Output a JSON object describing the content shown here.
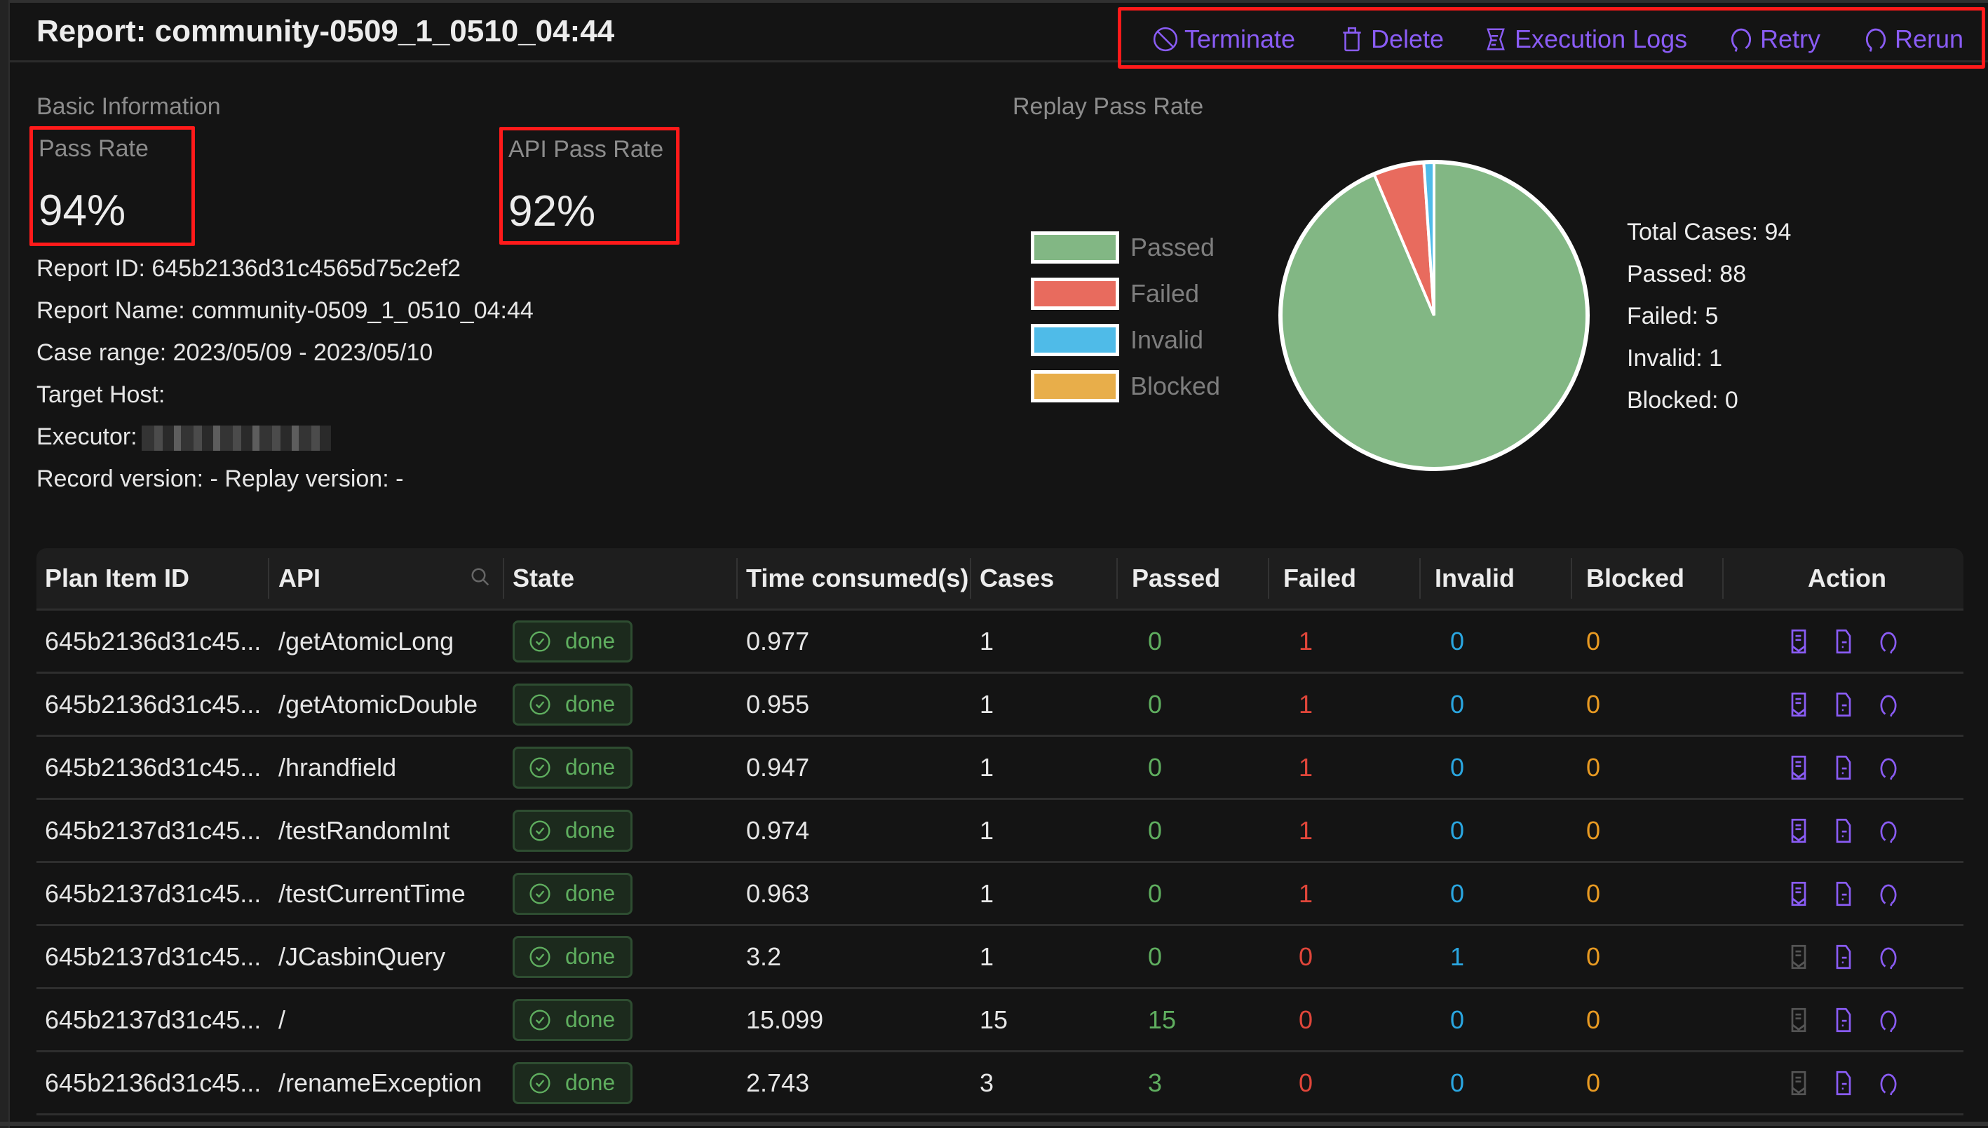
{
  "header": {
    "title": "Report: community-0509_1_0510_04:44",
    "actions": [
      {
        "label": "Terminate",
        "icon": "ban-icon"
      },
      {
        "label": "Delete",
        "icon": "trash-icon"
      },
      {
        "label": "Execution Logs",
        "icon": "scroll-icon"
      },
      {
        "label": "Retry",
        "icon": "refresh-icon"
      },
      {
        "label": "Rerun",
        "icon": "refresh-icon"
      }
    ]
  },
  "basic_info": {
    "section_label": "Basic Information",
    "pass_rate": {
      "label": "Pass Rate",
      "value": "94%"
    },
    "api_pass_rate": {
      "label": "API Pass Rate",
      "value": "92%"
    },
    "lines": {
      "report_id": "Report ID: 645b2136d31c4565d75c2ef2",
      "report_name": "Report Name: community-0509_1_0510_04:44",
      "case_range": "Case range: 2023/05/09 - 2023/05/10",
      "target_host": "Target Host:",
      "executor": "Executor:",
      "versions": "Record version: - Replay version: -"
    }
  },
  "replay": {
    "section_label": "Replay Pass Rate",
    "stats": {
      "total": "Total Cases: 94",
      "passed": "Passed: 88",
      "failed": "Failed: 5",
      "invalid": "Invalid: 1",
      "blocked": "Blocked: 0"
    }
  },
  "chart_data": {
    "type": "pie",
    "title": "Replay Pass Rate",
    "categories": [
      "Passed",
      "Failed",
      "Invalid",
      "Blocked"
    ],
    "values": [
      88,
      5,
      1,
      0
    ],
    "colors": [
      "#82b784",
      "#e86b5e",
      "#4fbbe8",
      "#e8ae4a"
    ],
    "legend": "left"
  },
  "table": {
    "columns": [
      "Plan Item ID",
      "API",
      "State",
      "Time consumed(s)",
      "Cases",
      "Passed",
      "Failed",
      "Invalid",
      "Blocked",
      "Action"
    ],
    "rows": [
      {
        "id": "645b2136d31c45...",
        "api": "/getAtomicLong",
        "state": "done",
        "time": "0.977",
        "cases": "1",
        "passed": "0",
        "failed": "1",
        "invalid": "0",
        "blocked": "0",
        "diff_enabled": true
      },
      {
        "id": "645b2136d31c45...",
        "api": "/getAtomicDouble",
        "state": "done",
        "time": "0.955",
        "cases": "1",
        "passed": "0",
        "failed": "1",
        "invalid": "0",
        "blocked": "0",
        "diff_enabled": true
      },
      {
        "id": "645b2136d31c45...",
        "api": "/hrandfield",
        "state": "done",
        "time": "0.947",
        "cases": "1",
        "passed": "0",
        "failed": "1",
        "invalid": "0",
        "blocked": "0",
        "diff_enabled": true
      },
      {
        "id": "645b2137d31c45...",
        "api": "/testRandomInt",
        "state": "done",
        "time": "0.974",
        "cases": "1",
        "passed": "0",
        "failed": "1",
        "invalid": "0",
        "blocked": "0",
        "diff_enabled": true
      },
      {
        "id": "645b2137d31c45...",
        "api": "/testCurrentTime",
        "state": "done",
        "time": "0.963",
        "cases": "1",
        "passed": "0",
        "failed": "1",
        "invalid": "0",
        "blocked": "0",
        "diff_enabled": true
      },
      {
        "id": "645b2137d31c45...",
        "api": "/JCasbinQuery",
        "state": "done",
        "time": "3.2",
        "cases": "1",
        "passed": "0",
        "failed": "0",
        "invalid": "1",
        "blocked": "0",
        "diff_enabled": false
      },
      {
        "id": "645b2137d31c45...",
        "api": "/",
        "state": "done",
        "time": "15.099",
        "cases": "15",
        "passed": "15",
        "failed": "0",
        "invalid": "0",
        "blocked": "0",
        "diff_enabled": false
      },
      {
        "id": "645b2136d31c45...",
        "api": "/renameException",
        "state": "done",
        "time": "2.743",
        "cases": "3",
        "passed": "3",
        "failed": "0",
        "invalid": "0",
        "blocked": "0",
        "diff_enabled": false
      }
    ]
  },
  "colors": {
    "accent": "#8a5cf5",
    "highlight_border": "#ff1a1a",
    "passed": "#5fae5f",
    "failed": "#e0463a",
    "invalid": "#2aa6e0",
    "blocked": "#e89a22",
    "disabled_icon": "#555555"
  }
}
